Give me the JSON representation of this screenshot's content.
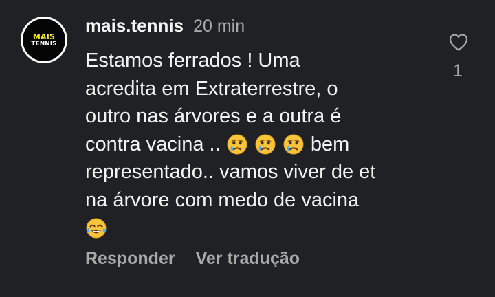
{
  "comment": {
    "username": "mais.tennis",
    "timestamp": "20 min",
    "avatar": {
      "line1": "MAIS",
      "line2": "TENNIS"
    },
    "text_lines": [
      "Estamos ferrados ! Uma",
      "acredita em Extraterrestre, o",
      "outro nas árvores e a outra é",
      "contra vacina ..",
      "bem",
      "representado.. vamos viver de et",
      "na árvore com medo de vacina"
    ],
    "emojis": [
      "crying-face",
      "crying-face",
      "crying-face",
      "tears-of-joy"
    ],
    "like_icon": "heart-outline",
    "like_count": "1",
    "actions": {
      "reply": "Responder",
      "translate": "Ver tradução"
    }
  },
  "colors": {
    "background": "#1f2124",
    "primary_text": "#f3f3f3",
    "secondary_text": "#a8a8a8",
    "logo_yellow": "#f7ea29"
  }
}
